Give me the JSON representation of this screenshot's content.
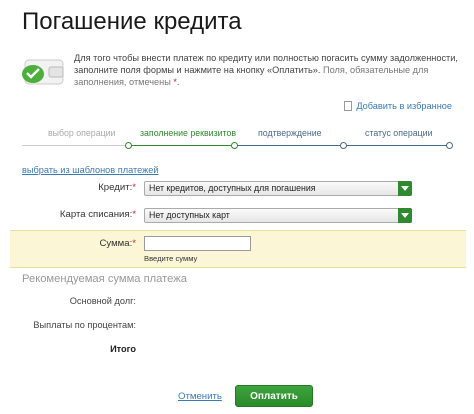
{
  "page": {
    "title": "Погашение кредита"
  },
  "intro": {
    "line1": "Для того чтобы внести платеж по кредиту или полностью погасить сумму задолженности, заполните поля формы и нажмите на кнопку «Оплатить».",
    "line2": "Поля, обязательные для заполнения, отмечены",
    "required_mark": "*",
    "line2_end": "."
  },
  "favorites": {
    "label": "Добавить в избранное"
  },
  "steps": [
    {
      "label": "выбор операции",
      "state": "done"
    },
    {
      "label": "заполнение реквизитов",
      "state": "active"
    },
    {
      "label": "подтверждение",
      "state": "todo"
    },
    {
      "label": "статус операции",
      "state": "todo"
    }
  ],
  "templates_link": "выбрать из шаблонов платежей",
  "form": {
    "credit_label": "Кредит:",
    "credit_value": "Нет кредитов, доступных для погашения",
    "card_label": "Карта списания:",
    "card_value": "Нет доступных карт",
    "sum_label": "Сумма:",
    "sum_value": "",
    "sum_hint": "Введите сумму",
    "required_mark": "*"
  },
  "recommended": {
    "title": "Рекомендуемая сумма платежа",
    "principal_label": "Основной долг:",
    "interest_label": "Выплаты по процентам:",
    "total_label": "Итого"
  },
  "actions": {
    "cancel_label": "Отменить",
    "pay_label": "Оплатить"
  },
  "colors": {
    "accent_green": "#2f8a2f",
    "link_blue": "#3a7bb5",
    "highlight_band": "#fbf7d6",
    "required_red": "#dd2222"
  }
}
